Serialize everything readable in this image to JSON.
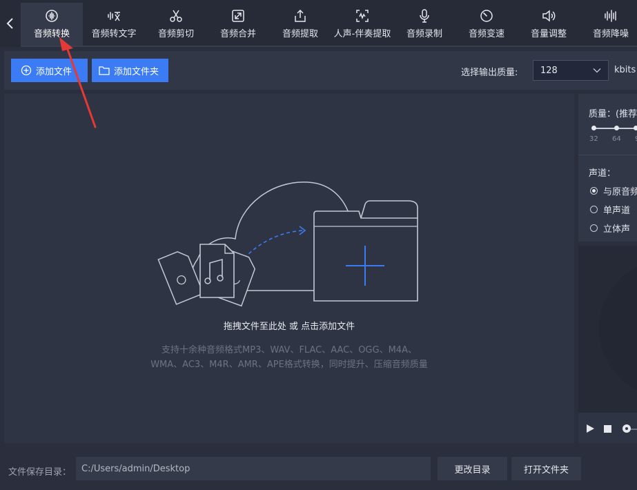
{
  "toolbar": {
    "tabs": [
      {
        "label": "音频转换",
        "icon": "audio-convert-icon"
      },
      {
        "label": "音频转文字",
        "icon": "speech-to-text-icon"
      },
      {
        "label": "音频剪切",
        "icon": "scissors-icon"
      },
      {
        "label": "音频合并",
        "icon": "merge-icon"
      },
      {
        "label": "音频提取",
        "icon": "upload-icon"
      },
      {
        "label": "人声-伴奏提取",
        "icon": "vocal-extract-icon"
      },
      {
        "label": "音频录制",
        "icon": "microphone-icon"
      },
      {
        "label": "音频变速",
        "icon": "speed-dial-icon"
      },
      {
        "label": "音量调整",
        "icon": "volume-icon"
      },
      {
        "label": "音频降噪",
        "icon": "noise-reduce-icon"
      }
    ]
  },
  "actions": {
    "add_file": "添加文件",
    "add_folder": "添加文件夹",
    "quality_label": "选择输出质量:",
    "quality_value": "128",
    "quality_unit": "kbits"
  },
  "drop": {
    "hint": "拖拽文件至此处 或 点击添加文件",
    "desc_line1": "支持十余种音频格式MP3、WAV、FLAC、AAC、OGG、M4A、",
    "desc_line2": "WMA、AC3、M4R、AMR、APE格式转换，同时提升、压缩音频质量"
  },
  "settings": {
    "quality_title": "质量：(推荐",
    "slider_ticks": [
      "32",
      "64",
      "9"
    ],
    "channel_title": "声道：",
    "channel_options": [
      "与原音频",
      "单声道",
      "立体声"
    ],
    "channel_selected": 0
  },
  "bottom": {
    "save_label": "文件保存目录：",
    "save_path": "C:/Users/admin/Desktop",
    "change_dir": "更改目录",
    "open_folder": "打开文件夹"
  },
  "colors": {
    "accent": "#3b7cf4",
    "annotation_arrow": "#e53935"
  }
}
